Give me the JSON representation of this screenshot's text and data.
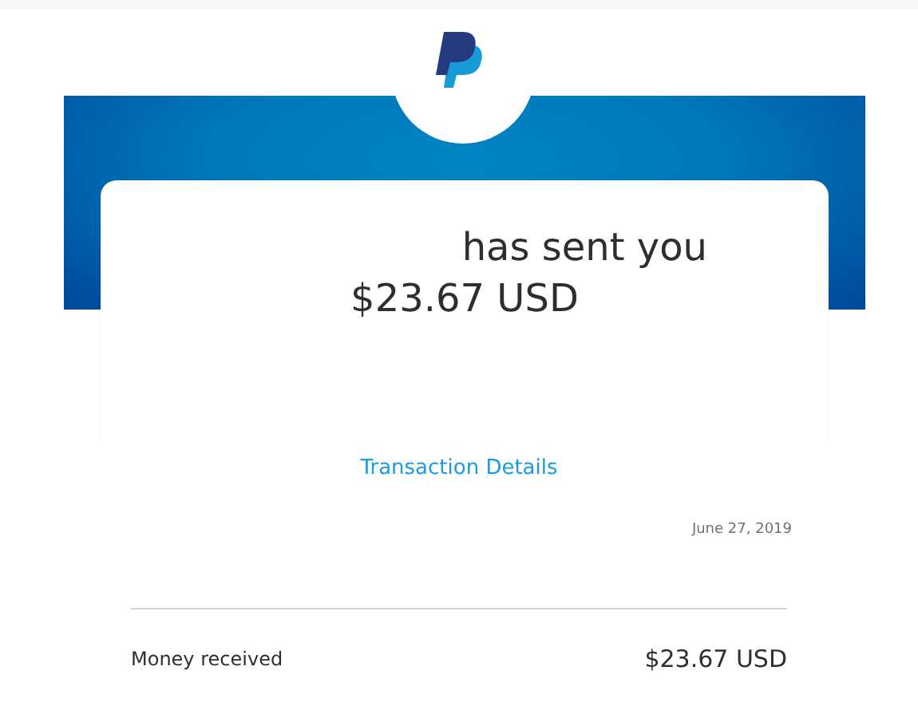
{
  "message": {
    "headline": "has sent you",
    "amount": "$23.67 USD"
  },
  "link": "Transaction Details",
  "date": "June 27, 2019",
  "summary": {
    "label": "Money received",
    "amount": "$23.67 USD"
  }
}
